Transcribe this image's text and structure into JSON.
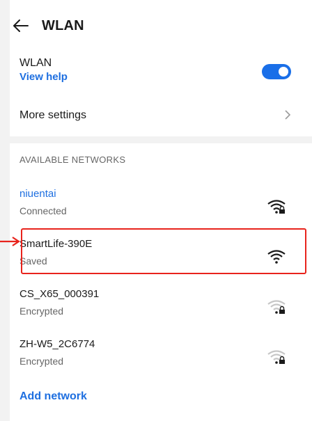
{
  "header": {
    "title": "WLAN"
  },
  "wlan_toggle": {
    "label": "WLAN",
    "help": "View help",
    "enabled": true
  },
  "more_settings": {
    "label": "More settings"
  },
  "section": {
    "title": "AVAILABLE NETWORKS"
  },
  "networks": [
    {
      "name": "niuentai",
      "status": "Connected",
      "signal": "strong-locked",
      "connected": true
    },
    {
      "name": "SmartLife-390E",
      "status": "Saved",
      "signal": "strong-open",
      "connected": false
    },
    {
      "name": "CS_X65_000391",
      "status": "Encrypted",
      "signal": "weak-locked",
      "connected": false
    },
    {
      "name": "ZH-W5_2C6774",
      "status": "Encrypted",
      "signal": "weak-locked",
      "connected": false
    }
  ],
  "add_network": {
    "label": "Add network"
  },
  "colors": {
    "accent": "#1e6fe0",
    "highlight": "#e8231c"
  }
}
